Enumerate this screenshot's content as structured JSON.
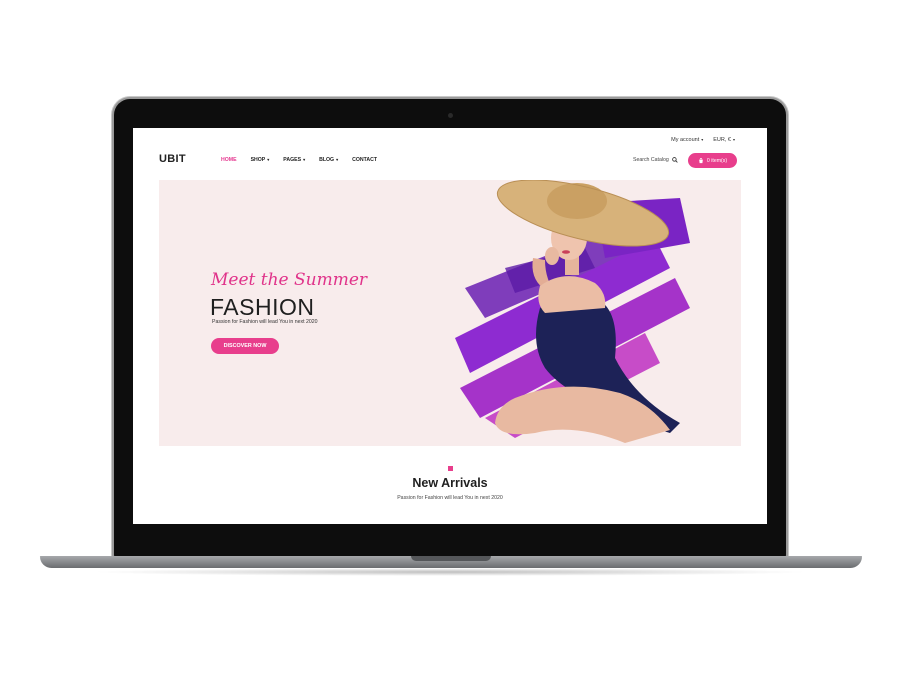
{
  "topbar": {
    "account": "My account",
    "currency": "EUR, €"
  },
  "header": {
    "logo": "UBIT",
    "nav": [
      {
        "label": "HOME",
        "dropdown": false,
        "active": true
      },
      {
        "label": "SHOP",
        "dropdown": true
      },
      {
        "label": "PAGES",
        "dropdown": true
      },
      {
        "label": "BLOG",
        "dropdown": true
      },
      {
        "label": "CONTACT",
        "dropdown": false
      }
    ],
    "search_label": "Search Catalog",
    "cart_label": "0 item(s)"
  },
  "hero": {
    "script_title": "Meet the Summer",
    "title": "FASHION",
    "subtitle": "Passion for Fashion will lead You in next 2020",
    "button": "DISCOVER NOW"
  },
  "section": {
    "title": "New Arrivals",
    "subtitle": "Passion for Fashion will lead You in next 2020"
  },
  "colors": {
    "accent": "#e83e8c",
    "hero_bg": "#f8ecec",
    "brush": "#8e2bd1"
  },
  "icons": [
    "search-icon",
    "cart-icon",
    "chevron-down-icon"
  ]
}
